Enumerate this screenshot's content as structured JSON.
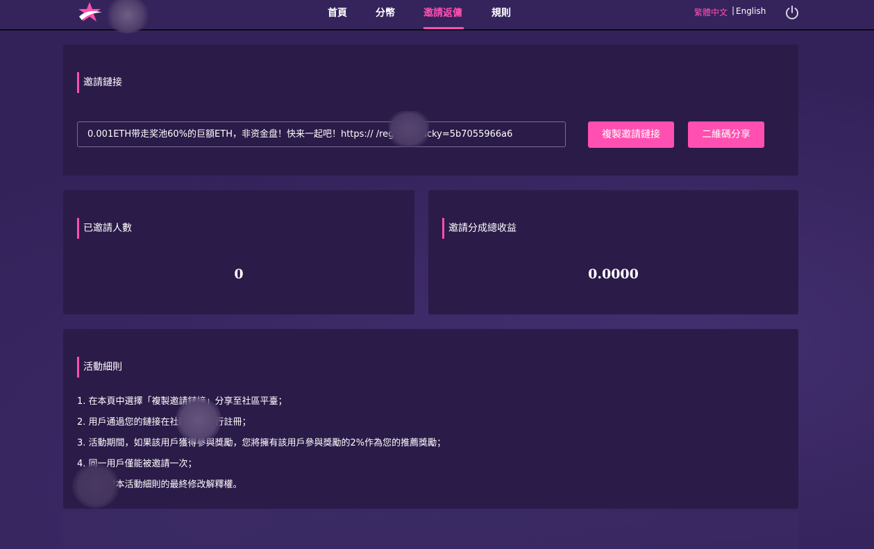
{
  "nav": {
    "items": [
      {
        "label": "首頁",
        "active": false
      },
      {
        "label": "分幣",
        "active": false
      },
      {
        "label": "邀請返傭",
        "active": true
      },
      {
        "label": "規則",
        "active": false
      }
    ],
    "lang_zh": "繁體中文",
    "lang_sep": "|",
    "lang_en": "English",
    "power_icon": "power-icon",
    "accent_color": "#ff4fb1"
  },
  "invite": {
    "title": "邀請鏈接",
    "link_text": "0.001ETH带走奖池60%的巨額ETH，非资金盘！快来一起吧！https://          /register?lucky=5b7055966a6",
    "copy_button": "複製邀請鏈接",
    "qr_button": "二維碼分享"
  },
  "stats": {
    "invited_title": "已邀請人數",
    "invited_value": "0",
    "earnings_title": "邀請分成總收益",
    "earnings_value": "0.0000"
  },
  "rules": {
    "title": "活動細則",
    "items": [
      "1. 在本頁中選擇「複製邀請鏈接」分享至社區平臺；",
      "2. 用戶通過您的鏈接在社區平臺進行註冊；",
      "3. 活動期間，如果該用戶獲得參與獎勵，您將擁有該用戶參與獎勵的2%作為您的推薦獎勵；",
      "4. 同一用戶僅能被邀請一次；",
      "5. 保留對本活動細則的最終修改解釋權。"
    ]
  }
}
